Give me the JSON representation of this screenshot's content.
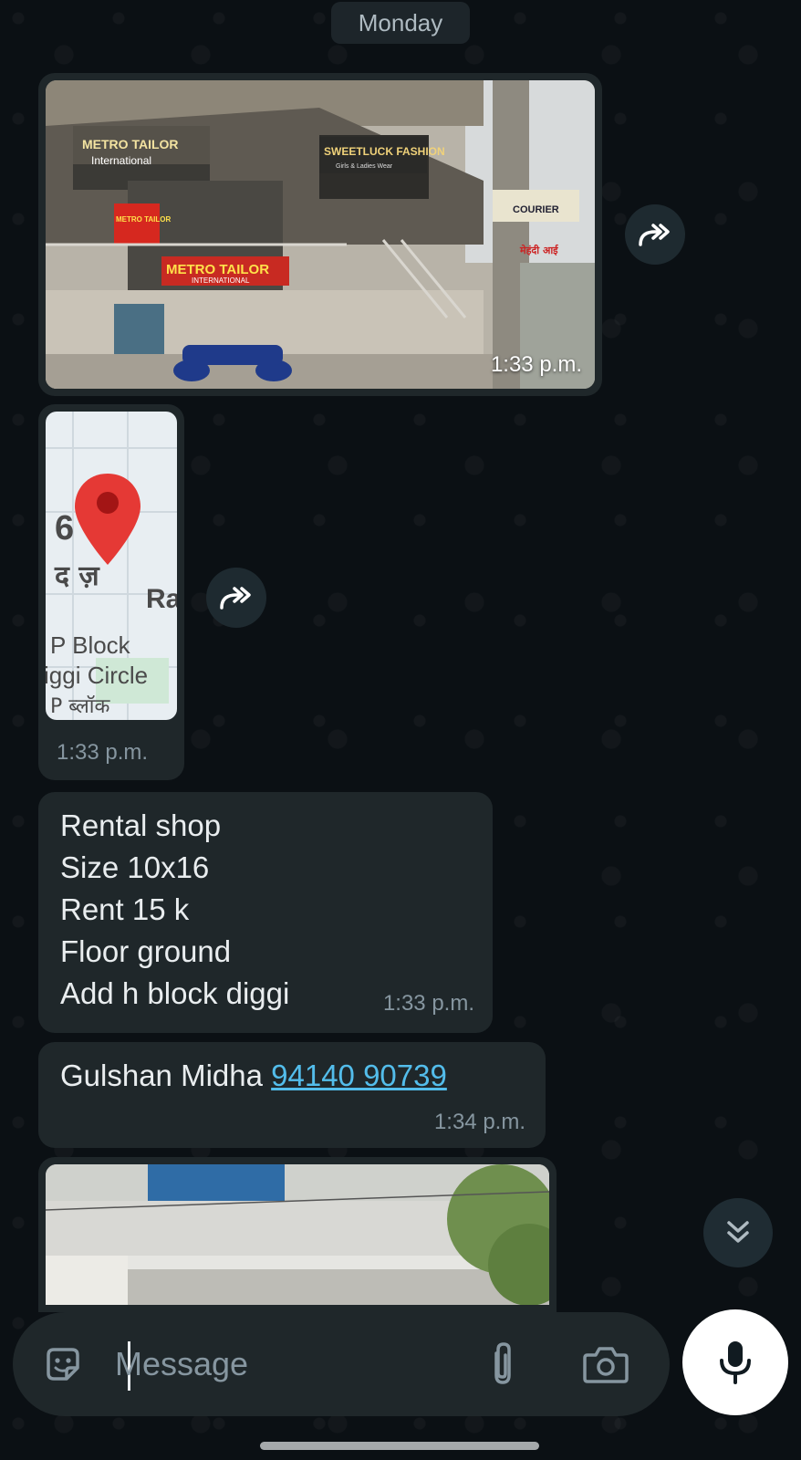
{
  "chat": {
    "day_label": "Monday",
    "messages": [
      {
        "type": "image",
        "description_icon": "shop-photo",
        "time": "1:33 p.m."
      },
      {
        "type": "location",
        "map_labels": [
          "6",
          "द ज़",
          "Ra",
          "P Block",
          "iggi Circle",
          "P ब्लॉक"
        ],
        "time": "1:33 p.m."
      },
      {
        "type": "text",
        "lines": [
          "Rental shop",
          "Size 10x16",
          "Rent 15 k",
          "Floor ground",
          "Add h block diggi"
        ],
        "time": "1:33 p.m."
      },
      {
        "type": "contact",
        "name": "Gulshan Midha",
        "phone": "94140 90739",
        "time": "1:34 p.m."
      },
      {
        "type": "image",
        "description_icon": "building-photo",
        "time": ""
      }
    ]
  },
  "shop_signs": {
    "sign1": "METRO TAILOR",
    "sign1_sub": "International",
    "sign2": "METRO TAILOR",
    "sign2_sub": "INTERNATIONAL",
    "sign3": "SWEETLUCK FASHION",
    "sign3_sub": "Girls & Ladies Wear",
    "sign4": "COURIER",
    "sign5": "METRO TAILOR",
    "sign6": "मेहंदी आई"
  },
  "composer": {
    "placeholder": "Message",
    "sticker_icon": "sticker-icon",
    "attach_icon": "paperclip-icon",
    "camera_icon": "camera-icon",
    "mic_icon": "mic-icon"
  },
  "colors": {
    "background": "#0b1014",
    "bubble": "#1f272a",
    "link": "#53bdeb",
    "timestamp": "#8696a0",
    "accent": "#00a884"
  }
}
